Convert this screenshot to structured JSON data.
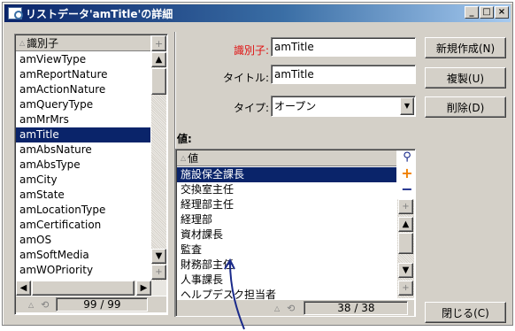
{
  "window": {
    "title": "リストデータ'amTitle'の詳細",
    "min_label": "_",
    "max_label": "□",
    "close_label": "×"
  },
  "left_list": {
    "column_header": "識別子",
    "items": [
      "amViewType",
      "amReportNature",
      "amActionNature",
      "amQueryType",
      "amMrMrs",
      "amTitle",
      "amAbsNature",
      "amAbsType",
      "amCity",
      "amState",
      "amLocationType",
      "amCertification",
      "amOS",
      "amSoftMedia",
      "amWOPriority"
    ],
    "selected_index": 5,
    "counter": "99 / 99",
    "add_label": "+"
  },
  "form": {
    "id_label": "識別子:",
    "id_value": "amTitle",
    "title_label": "タイトル:",
    "title_value": "amTitle",
    "type_label": "タイプ:",
    "type_value": "オープン",
    "values_label": "値:"
  },
  "buttons": {
    "new": "新規作成(N)",
    "duplicate": "複製(U)",
    "delete": "削除(D)",
    "close": "閉じる(C)"
  },
  "value_list": {
    "column_header": "値",
    "items": [
      "施設保全課長",
      "交換室主任",
      "経理部主任",
      "経理部",
      "資材課長",
      "監査",
      "財務部主任",
      "人事課長",
      "ヘルプデスク担当者"
    ],
    "selected_index": 0,
    "counter": "38 / 38",
    "add_label": "+",
    "remove_label": "−"
  },
  "colors": {
    "title_gradient_start": "#0a246a",
    "selection": "#0a246a",
    "required_label": "#e01010",
    "annotation_arrow": "#1a2a8a"
  }
}
